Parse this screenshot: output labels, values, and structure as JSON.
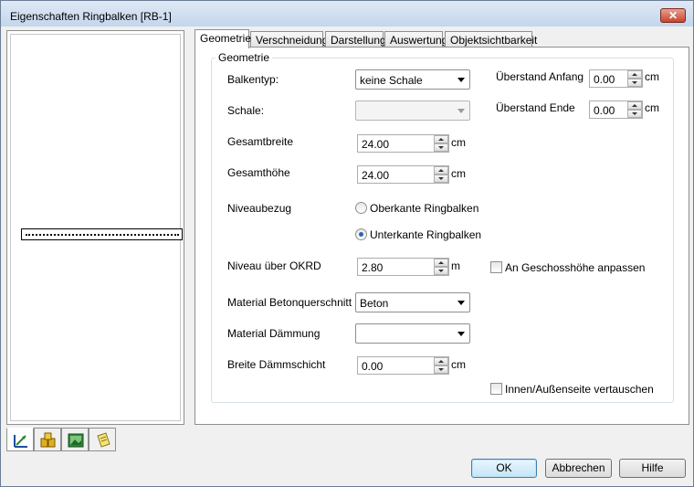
{
  "window": {
    "title": "Eigenschaften Ringbalken [RB-1]",
    "close_glyph": "✕"
  },
  "left_tabs": [
    {
      "icon": "dimension-icon"
    },
    {
      "icon": "material-stack-icon"
    },
    {
      "icon": "picture-icon"
    },
    {
      "icon": "note-icon"
    }
  ],
  "tabs": [
    "Geometrie",
    "Verschneidung",
    "Darstellung",
    "Auswertung",
    "Objektsichtbarkeit"
  ],
  "active_tab": "Geometrie",
  "group": {
    "title": "Geometrie",
    "balkentyp": {
      "label": "Balkentyp:",
      "value": "keine Schale"
    },
    "schale": {
      "label": "Schale:",
      "value": ""
    },
    "gesamtbreite": {
      "label": "Gesamtbreite",
      "value": "24.00",
      "unit": "cm"
    },
    "gesamthoehe": {
      "label": "Gesamthöhe",
      "value": "24.00",
      "unit": "cm"
    },
    "niveaubezug": {
      "label": "Niveaubezug",
      "options": [
        "Oberkante Ringbalken",
        "Unterkante Ringbalken"
      ],
      "selected": "Unterkante Ringbalken"
    },
    "niveau": {
      "label": "Niveau über OKRD",
      "value": "2.80",
      "unit": "m"
    },
    "anpassen": {
      "label": "An Geschosshöhe anpassen",
      "checked": false
    },
    "material_beton": {
      "label": "Material Betonquerschnitt",
      "value": "Beton"
    },
    "material_daemmung": {
      "label": "Material Dämmung",
      "value": ""
    },
    "breite_daemm": {
      "label": "Breite Dämmschicht",
      "value": "0.00",
      "unit": "cm"
    },
    "ueberstand_anfang": {
      "label": "Überstand Anfang",
      "value": "0.00",
      "unit": "cm"
    },
    "ueberstand_ende": {
      "label": "Überstand Ende",
      "value": "0.00",
      "unit": "cm"
    },
    "vertauschen": {
      "label": "Innen/Außenseite vertauschen",
      "checked": false
    }
  },
  "buttons": {
    "ok": "OK",
    "cancel": "Abbrechen",
    "help": "Hilfe"
  }
}
